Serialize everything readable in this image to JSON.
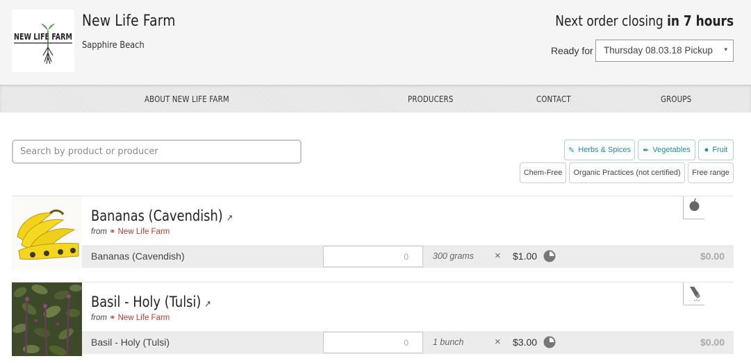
{
  "header": {
    "logo_text": "NEW LIFE FARM",
    "farm_name": "New Life Farm",
    "location": "Sapphire Beach",
    "closing_prefix": "Next order closing",
    "closing_time": "in 7 hours",
    "ready_label": "Ready for",
    "ready_selected": "Thursday 08.03.18 Pickup"
  },
  "nav": {
    "items": [
      "ABOUT NEW LIFE FARM",
      "PRODUCERS",
      "CONTACT",
      "GROUPS"
    ]
  },
  "search": {
    "placeholder": "Search by product or producer"
  },
  "filters": {
    "categories": [
      {
        "label": "Herbs & Spices",
        "icon": "herbs-icon"
      },
      {
        "label": "Vegetables",
        "icon": "carrot-icon"
      },
      {
        "label": "Fruit",
        "icon": "apple-icon"
      }
    ],
    "properties": [
      "Chem-Free",
      "Organic Practices (not certified)",
      "Free range"
    ]
  },
  "products": [
    {
      "title": "Bananas (Cavendish)",
      "from_label": "from",
      "producer": "New Life Farm",
      "variant": "Bananas (Cavendish)",
      "quantity": "0",
      "unit": "300 grams",
      "times": "×",
      "price": "$1.00",
      "total": "$0.00",
      "category_icon": "apple-icon",
      "image": "bananas-image"
    },
    {
      "title": "Basil - Holy (Tulsi)",
      "from_label": "from",
      "producer": "New Life Farm",
      "variant": "Basil - Holy (Tulsi)",
      "quantity": "0",
      "unit": "1 bunch",
      "times": "×",
      "price": "$3.00",
      "total": "$0.00",
      "category_icon": "herbs-icon",
      "image": "basil-image"
    }
  ],
  "colors": {
    "accent": "#1a8fa3",
    "producer_link": "#c0392b",
    "header_bg": "#f5f5f5",
    "row_bg": "#ececec"
  }
}
